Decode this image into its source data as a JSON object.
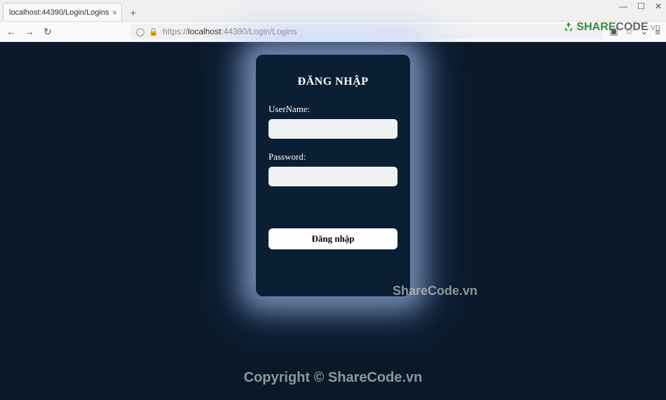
{
  "window": {
    "minimize": "—",
    "maximize": "☐",
    "close": "✕"
  },
  "browser": {
    "tab_title": "localhost:44390/Login/Logins",
    "new_tab": "+",
    "tab_close": "×",
    "back": "←",
    "forward": "→",
    "reload": "↻",
    "shield": "◯",
    "lock": "🔒",
    "url_prefix": "https://",
    "url_host": "localhost",
    "url_path": ":44390/Login/Logins",
    "reader": "▣",
    "bookmark": "☆",
    "pocket": "⌄",
    "menu": "≡"
  },
  "logo": {
    "share": "SHARE",
    "code": "CODE",
    "vn": ".vn"
  },
  "login": {
    "title": "ĐĂNG NHẬP",
    "username_label": "UserName:",
    "username_value": "",
    "password_label": "Password:",
    "password_value": "",
    "button": "Đăng nhập"
  },
  "watermark": {
    "center": "ShareCode.vn",
    "footer": "Copyright © ShareCode.vn"
  }
}
